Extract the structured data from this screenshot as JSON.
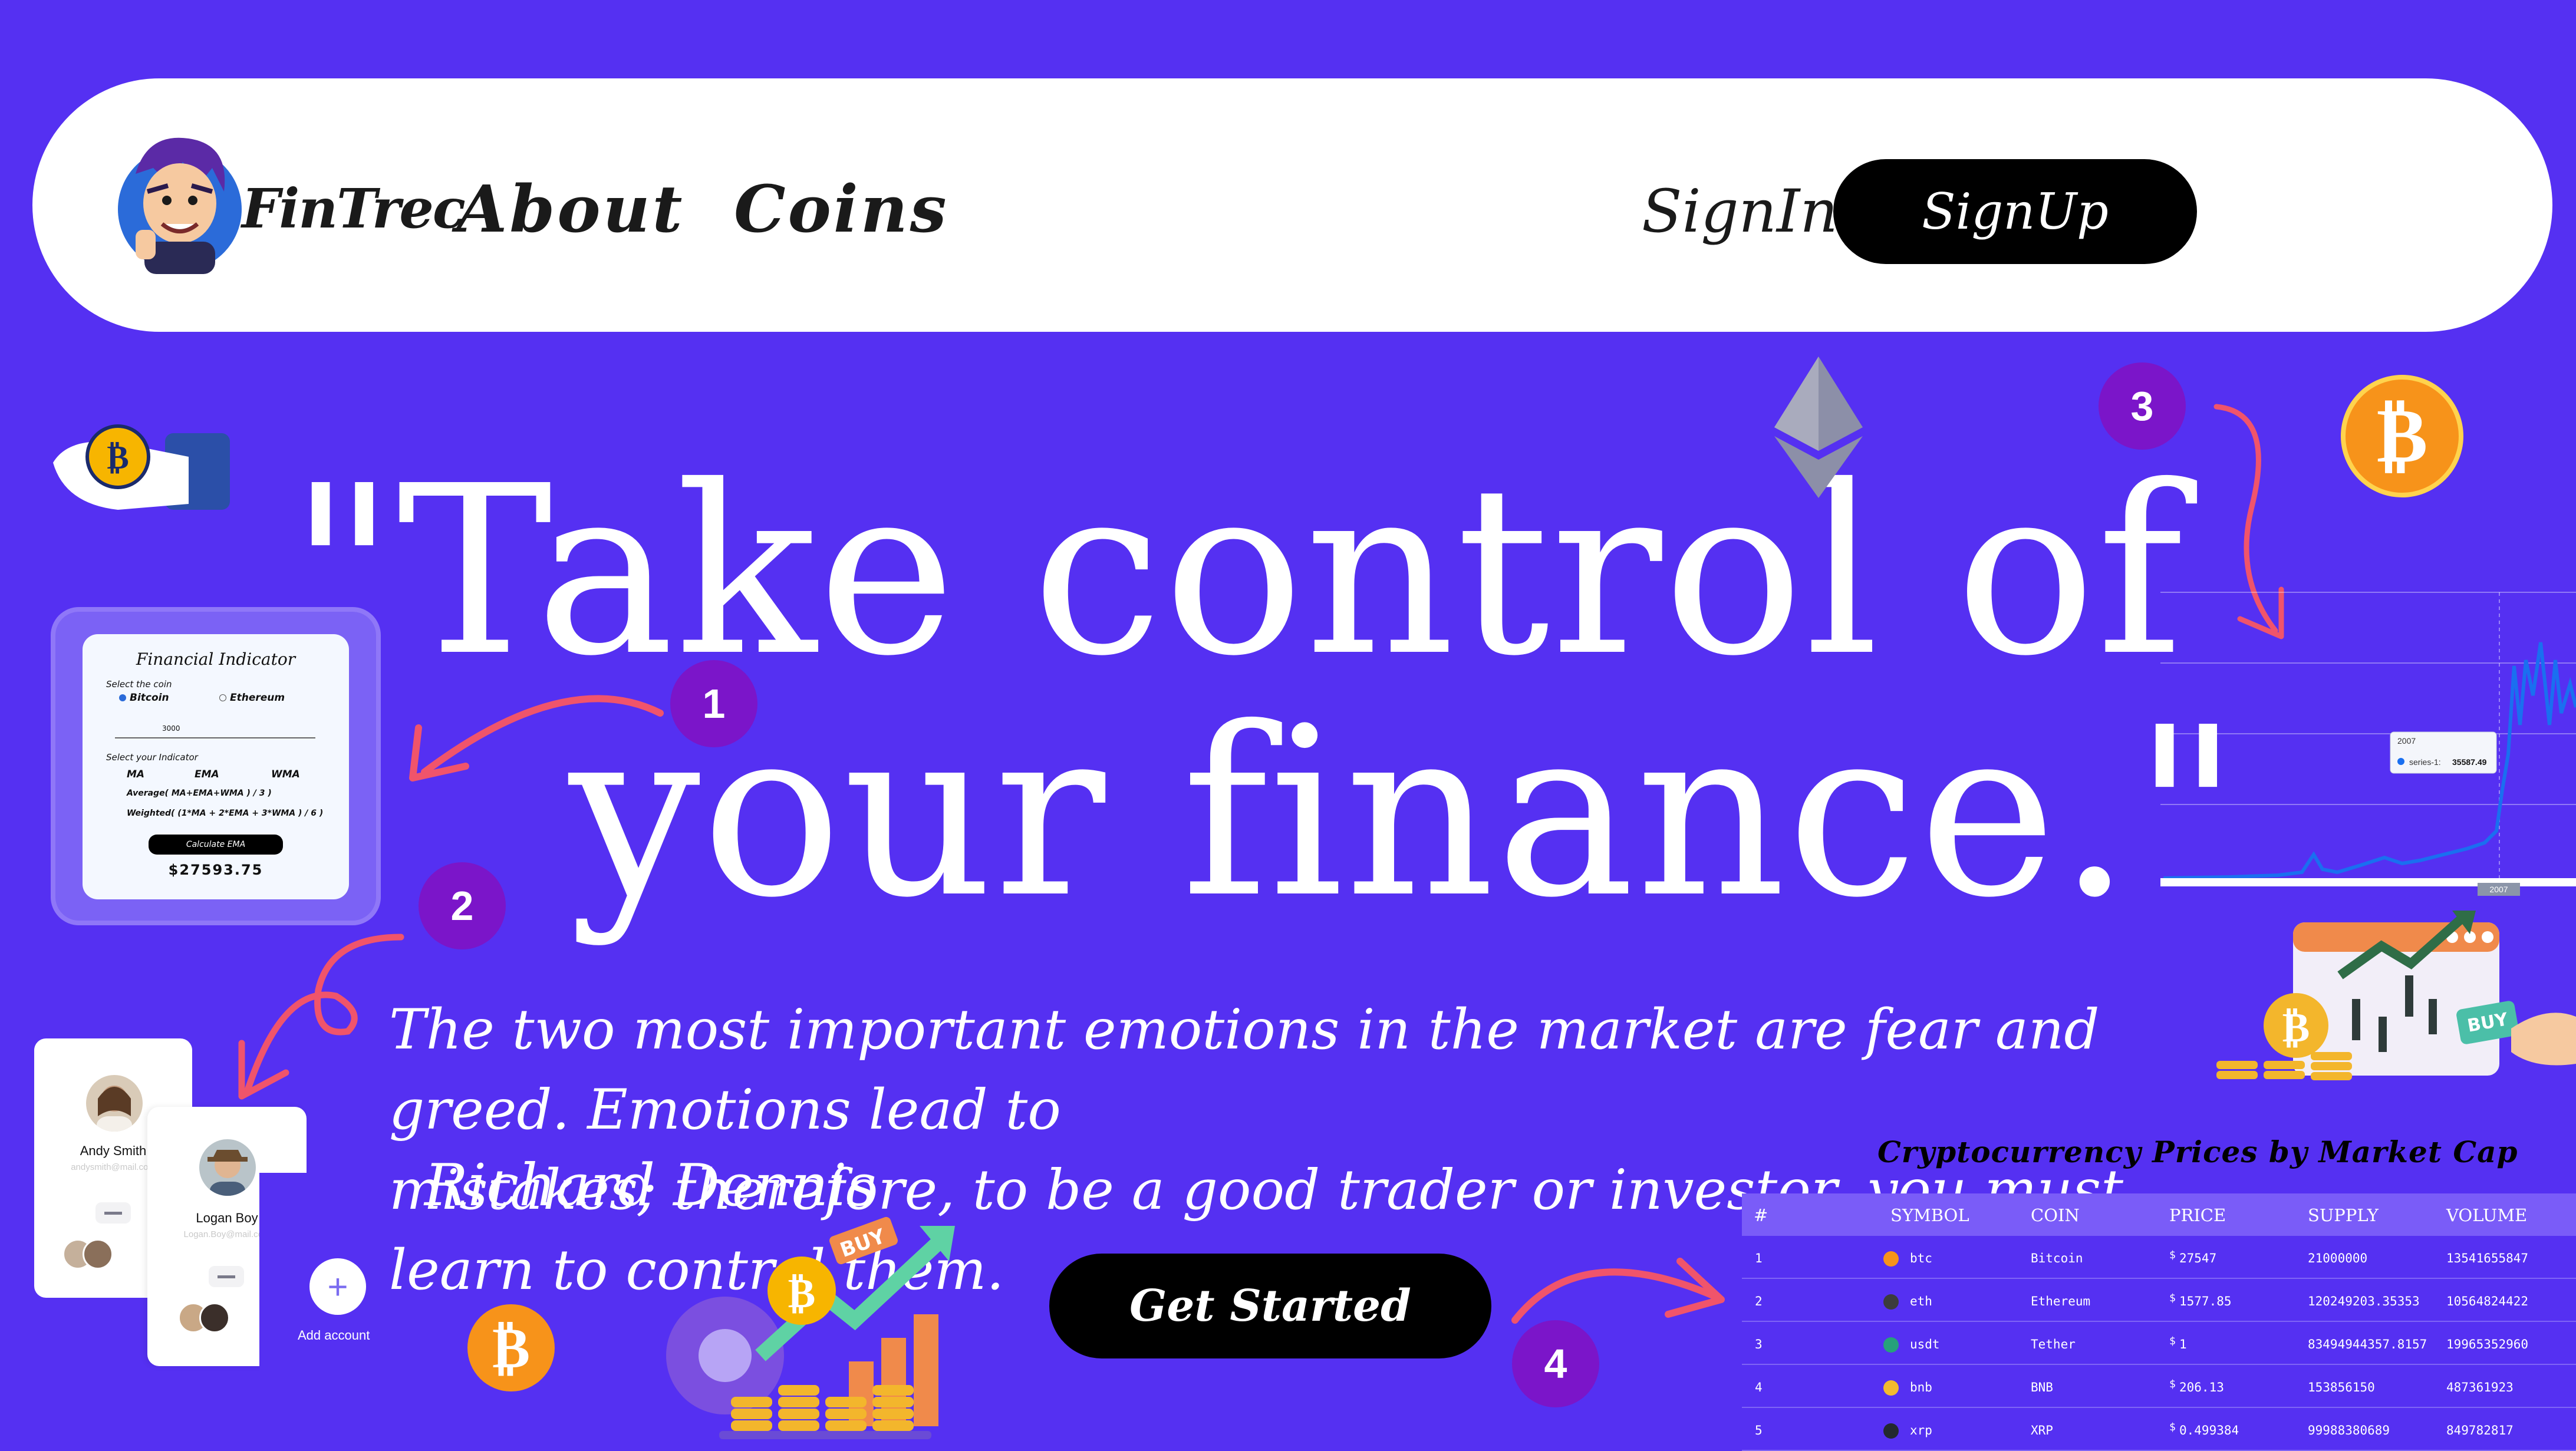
{
  "nav": {
    "brand": "FinTrec",
    "links": [
      "About",
      "Coins"
    ],
    "signin": "SignIn",
    "signup": "SignUp"
  },
  "hero": {
    "line1": "\"Take control of",
    "line2": "your finance.\"",
    "quote_line1": "The two most important emotions in the market are fear and greed. Emotions lead to",
    "quote_line2": "mistakes; therefore, to be a good trader or investor, you must learn to control them.",
    "author": "Richard Dennis",
    "cta": "Get Started"
  },
  "badges": [
    "1",
    "2",
    "3",
    "4"
  ],
  "financial_indicator": {
    "title": "Financial Indicator",
    "select_coin": "Select the coin",
    "coins": [
      "Bitcoin",
      "Ethereum"
    ],
    "amount": "3000",
    "select_indicator": "Select your Indicator",
    "indicators": [
      "MA",
      "EMA",
      "WMA"
    ],
    "average": "Average( MA+EMA+WMA ) / 3 )",
    "weighted": "Weighted( (1*MA + 2*EMA + 3*WMA ) / 6 )",
    "button": "Calculate EMA",
    "result": "$27593.75"
  },
  "accounts": [
    {
      "name": "Andy Smith",
      "email": "andysmith@mail.com"
    },
    {
      "name": "Logan Boy",
      "email": "Logan.Boy@mail.com"
    }
  ],
  "add_account": "Add account",
  "chart": {
    "tooltip_year": "2007",
    "tooltip_series": "series-1:",
    "tooltip_value": "35587.49",
    "axis_label": "2007"
  },
  "buy_label": "BUY",
  "market": {
    "title": "Cryptocurrency Prices by Market Cap",
    "headers": [
      "#",
      "SYMBOL",
      "COIN",
      "PRICE",
      "SUPPLY",
      "VOLUME"
    ],
    "rows": [
      {
        "rank": "1",
        "symbol": "btc",
        "coin": "Bitcoin",
        "price": "27547",
        "supply": "21000000",
        "volume": "13541655847",
        "color": "#f7931a"
      },
      {
        "rank": "2",
        "symbol": "eth",
        "coin": "Ethereum",
        "price": "1577.85",
        "supply": "120249203.35353",
        "volume": "10564824422",
        "color": "#3c3c3d"
      },
      {
        "rank": "3",
        "symbol": "usdt",
        "coin": "Tether",
        "price": "1",
        "supply": "83494944357.8157",
        "volume": "19965352960",
        "color": "#26a17b"
      },
      {
        "rank": "4",
        "symbol": "bnb",
        "coin": "BNB",
        "price": "206.13",
        "supply": "153856150",
        "volume": "487361923",
        "color": "#f3ba2f"
      },
      {
        "rank": "5",
        "symbol": "xrp",
        "coin": "XRP",
        "price": "0.499384",
        "supply": "99988380689",
        "volume": "849782817",
        "color": "#23292f"
      }
    ]
  },
  "colors": {
    "background": "#5530f2",
    "badge": "#7b15c9",
    "bitcoin": "#f7931a",
    "arrow": "#f0546b"
  }
}
